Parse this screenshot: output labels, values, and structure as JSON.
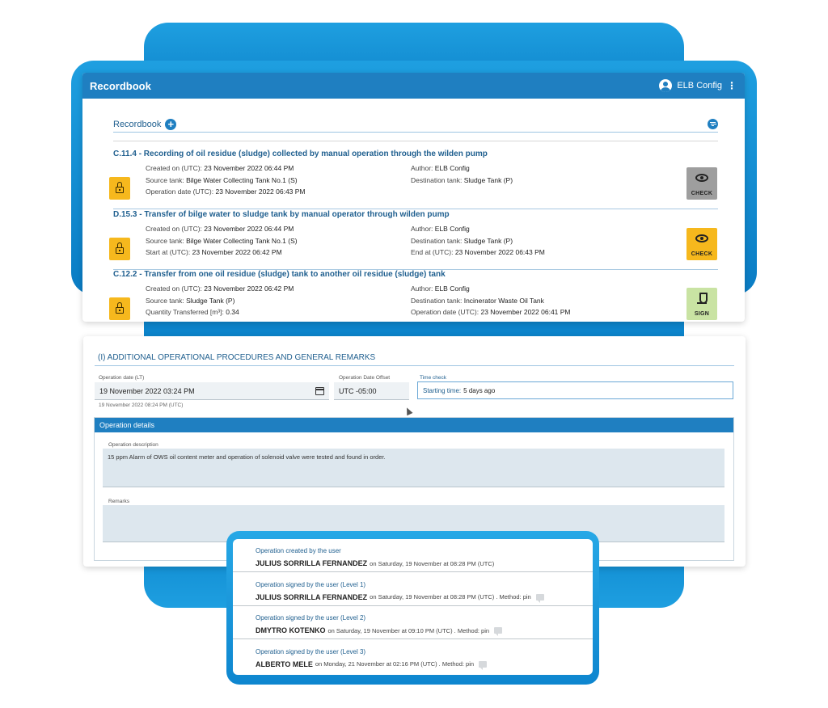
{
  "app": {
    "title": "Recordbook",
    "user": "ELB Config"
  },
  "recordbook": {
    "label": "Recordbook",
    "records": [
      {
        "title": "C.11.4 - Recording of oil residue (sludge) collected by manual operation through the wilden pump",
        "left": [
          {
            "k": "Created on (UTC):",
            "v": "23 November 2022 06:44 PM"
          },
          {
            "k": "Source tank:",
            "v": "Bilge Water Collecting Tank No.1 (S)"
          },
          {
            "k": "Operation date (UTC):",
            "v": "23 November 2022 06:43 PM"
          }
        ],
        "right": [
          {
            "k": "Author:",
            "v": "ELB Config"
          },
          {
            "k": "Destination tank:",
            "v": "Sludge Tank (P)"
          }
        ],
        "action": "CHECK",
        "action_color": "#9e9e9e"
      },
      {
        "title": "D.15.3 - Transfer of bilge water to sludge tank by manual operator through wilden pump",
        "left": [
          {
            "k": "Created on (UTC):",
            "v": "23 November 2022 06:44 PM"
          },
          {
            "k": "Source tank:",
            "v": "Bilge Water Collecting Tank No.1 (S)"
          },
          {
            "k": "Start at (UTC):",
            "v": "23 November 2022 06:42 PM"
          }
        ],
        "right": [
          {
            "k": "Author:",
            "v": "ELB Config"
          },
          {
            "k": "Destination tank:",
            "v": "Sludge Tank (P)"
          },
          {
            "k": "End at (UTC):",
            "v": "23 November 2022 06:43 PM"
          }
        ],
        "action": "CHECK",
        "action_color": "#f6b81d"
      },
      {
        "title": "C.12.2 - Transfer from one oil residue (sludge) tank to another oil residue (sludge) tank",
        "left": [
          {
            "k": "Created on (UTC):",
            "v": "23 November 2022 06:42 PM"
          },
          {
            "k": "Source tank:",
            "v": "Sludge Tank (P)"
          },
          {
            "k": "Quantity Transferred [m³]:",
            "v": "0.34"
          }
        ],
        "right": [
          {
            "k": "Author:",
            "v": "ELB Config"
          },
          {
            "k": "Destination tank:",
            "v": "Incinerator Waste Oil Tank"
          },
          {
            "k": "Operation date (UTC):",
            "v": "23 November 2022 06:41 PM"
          }
        ],
        "action": "SIGN",
        "action_color": "#c9e3a3"
      }
    ]
  },
  "procedures": {
    "title": "(I) ADDITIONAL OPERATIONAL PROCEDURES AND GENERAL REMARKS",
    "operation_date_label": "Operation date (LT)",
    "operation_date_value": "19 November 2022 03:24 PM",
    "operation_date_hint": "19 November 2022 08:24 PM (UTC)",
    "offset_label": "Operation Date Offset",
    "offset_value": "UTC -05:00",
    "time_check_label": "Time check",
    "time_check_key": "Starting time:",
    "time_check_value": "5 days ago",
    "details_title": "Operation details",
    "description_label": "Operation description",
    "description_value": "15 ppm Alarm of OWS oil content meter and operation of solenoid valve were tested and found in order.",
    "remarks_label": "Remarks",
    "remarks_value": ""
  },
  "history": [
    {
      "label": "Operation created by the user",
      "name": "JULIUS SORRILLA FERNANDEZ",
      "detail": "on Saturday, 19 November at 08:28 PM (UTC)",
      "has_icon": false
    },
    {
      "label": "Operation signed by the user (Level 1)",
      "name": "JULIUS SORRILLA FERNANDEZ",
      "detail": "on Saturday, 19 November at 08:28 PM (UTC) . Method: pin",
      "has_icon": true
    },
    {
      "label": "Operation signed by the user (Level 2)",
      "name": "DMYTRO KOTENKO",
      "detail": "on Saturday, 19 November at 09:10 PM (UTC) . Method: pin",
      "has_icon": true
    },
    {
      "label": "Operation signed by the user (Level 3)",
      "name": "ALBERTO MELE",
      "detail": "on Monday, 21 November at 02:16 PM (UTC) . Method: pin",
      "has_icon": true
    }
  ]
}
